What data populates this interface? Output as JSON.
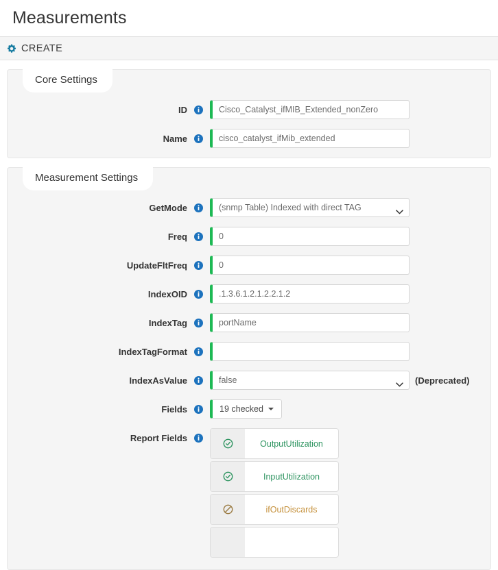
{
  "page": {
    "title": "Measurements"
  },
  "toolbar": {
    "gear_icon": "gear-icon",
    "create_label": "CREATE"
  },
  "panels": [
    {
      "legend": "Core Settings",
      "rows": [
        {
          "label": "ID",
          "type": "text",
          "value": "Cisco_Catalyst_ifMIB_Extended_nonZero",
          "info_icon": "info-icon"
        },
        {
          "label": "Name",
          "type": "text",
          "value": "cisco_catalyst_ifMib_extended",
          "info_icon": "info-icon"
        }
      ]
    },
    {
      "legend": "Measurement Settings",
      "rows": [
        {
          "label": "GetMode",
          "type": "select",
          "value": "(snmp Table) Indexed with direct TAG",
          "info_icon": "info-icon"
        },
        {
          "label": "Freq",
          "type": "text",
          "value": "0",
          "info_icon": "info-icon"
        },
        {
          "label": "UpdateFltFreq",
          "type": "text",
          "value": "0",
          "info_icon": "info-icon"
        },
        {
          "label": "IndexOID",
          "type": "text",
          "value": ".1.3.6.1.2.1.2.2.1.2",
          "info_icon": "info-icon"
        },
        {
          "label": "IndexTag",
          "type": "text",
          "value": "portName",
          "info_icon": "info-icon"
        },
        {
          "label": "IndexTagFormat",
          "type": "text",
          "value": "",
          "info_icon": "info-icon"
        },
        {
          "label": "IndexAsValue",
          "type": "select",
          "value": "false",
          "suffix": "(Deprecated)",
          "info_icon": "info-icon"
        },
        {
          "label": "Fields",
          "type": "dropdown-button",
          "value": "19 checked",
          "info_icon": "info-icon"
        },
        {
          "label": "Report Fields",
          "type": "report-list",
          "info_icon": "info-icon"
        }
      ]
    }
  ],
  "report_fields": [
    {
      "label": "OutputUtilization",
      "state": "on",
      "icon": "check-circle-icon"
    },
    {
      "label": "InputUtilization",
      "state": "on",
      "icon": "check-circle-icon"
    },
    {
      "label": "ifOutDiscards",
      "state": "off",
      "icon": "no-entry-circle-icon"
    },
    {
      "label": "",
      "state": "partial",
      "icon": ""
    }
  ],
  "colors": {
    "accent_green": "#1db954",
    "info_blue": "#1c72bd",
    "gear_teal": "#12799f",
    "report_on_text": "#2e9460",
    "report_off_text": "#c5913c",
    "panel_bg": "#f5f5f5"
  }
}
